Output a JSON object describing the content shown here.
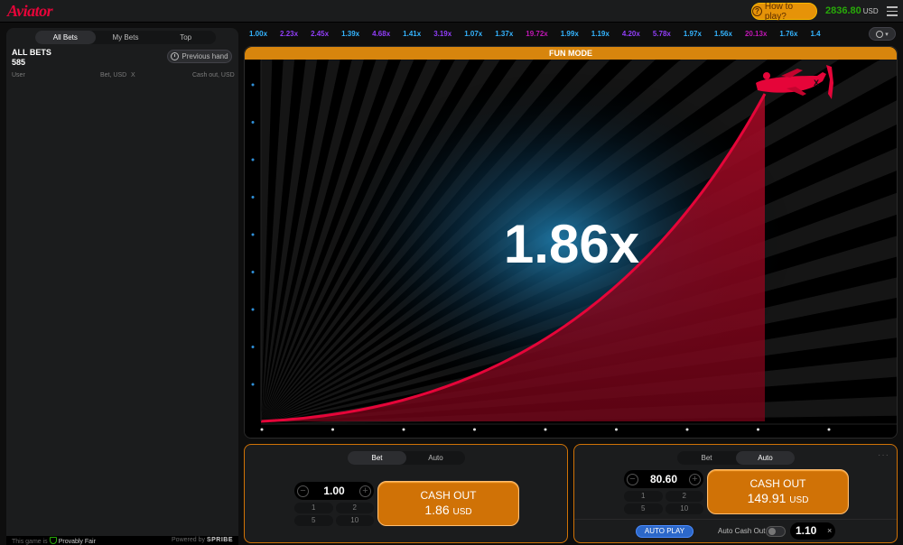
{
  "header": {
    "logo": "Aviator",
    "how_to_play": "How to play?",
    "balance": "2836.80",
    "currency": "USD"
  },
  "bets_panel": {
    "tabs": [
      "All Bets",
      "My Bets",
      "Top"
    ],
    "active_tab": "All Bets",
    "title": "ALL BETS",
    "count": "585",
    "previous_hand": "Previous hand",
    "columns": {
      "user": "User",
      "bet": "Bet, USD",
      "x": "X",
      "cashout": "Cash out, USD"
    },
    "footer_prefix": "This game is",
    "footer_fair": "Provably Fair",
    "footer_powered": "Powered by",
    "footer_brand": "SPRIBE"
  },
  "history": [
    {
      "v": "1.00x",
      "c": "#34b4ff"
    },
    {
      "v": "2.23x",
      "c": "#913ef8"
    },
    {
      "v": "2.45x",
      "c": "#913ef8"
    },
    {
      "v": "1.39x",
      "c": "#34b4ff"
    },
    {
      "v": "4.68x",
      "c": "#913ef8"
    },
    {
      "v": "1.41x",
      "c": "#34b4ff"
    },
    {
      "v": "3.19x",
      "c": "#913ef8"
    },
    {
      "v": "1.07x",
      "c": "#34b4ff"
    },
    {
      "v": "1.37x",
      "c": "#34b4ff"
    },
    {
      "v": "19.72x",
      "c": "#c017b4"
    },
    {
      "v": "1.99x",
      "c": "#34b4ff"
    },
    {
      "v": "1.19x",
      "c": "#34b4ff"
    },
    {
      "v": "4.20x",
      "c": "#913ef8"
    },
    {
      "v": "5.78x",
      "c": "#913ef8"
    },
    {
      "v": "1.97x",
      "c": "#34b4ff"
    },
    {
      "v": "1.56x",
      "c": "#34b4ff"
    },
    {
      "v": "20.13x",
      "c": "#c017b4"
    },
    {
      "v": "1.76x",
      "c": "#34b4ff"
    },
    {
      "v": "1.4",
      "c": "#34b4ff"
    }
  ],
  "game": {
    "mode_banner": "FUN MODE",
    "multiplier": "1.86x",
    "plane_color": "#e50539",
    "curve_color": "#e50539"
  },
  "panel_left": {
    "tabs": [
      "Bet",
      "Auto"
    ],
    "active_tab": "Bet",
    "amount": "1.00",
    "quick": [
      "1",
      "2",
      "5",
      "10"
    ],
    "cashout_label": "CASH OUT",
    "cashout_value": "1.86",
    "cashout_currency": "USD"
  },
  "panel_right": {
    "tabs": [
      "Bet",
      "Auto"
    ],
    "active_tab": "Auto",
    "amount": "80.60",
    "quick": [
      "1",
      "2",
      "5",
      "10"
    ],
    "cashout_label": "CASH OUT",
    "cashout_value": "149.91",
    "cashout_currency": "USD",
    "auto_play": "AUTO PLAY",
    "auto_cashout_label": "Auto Cash Out",
    "auto_cashout_value": "1.10"
  }
}
